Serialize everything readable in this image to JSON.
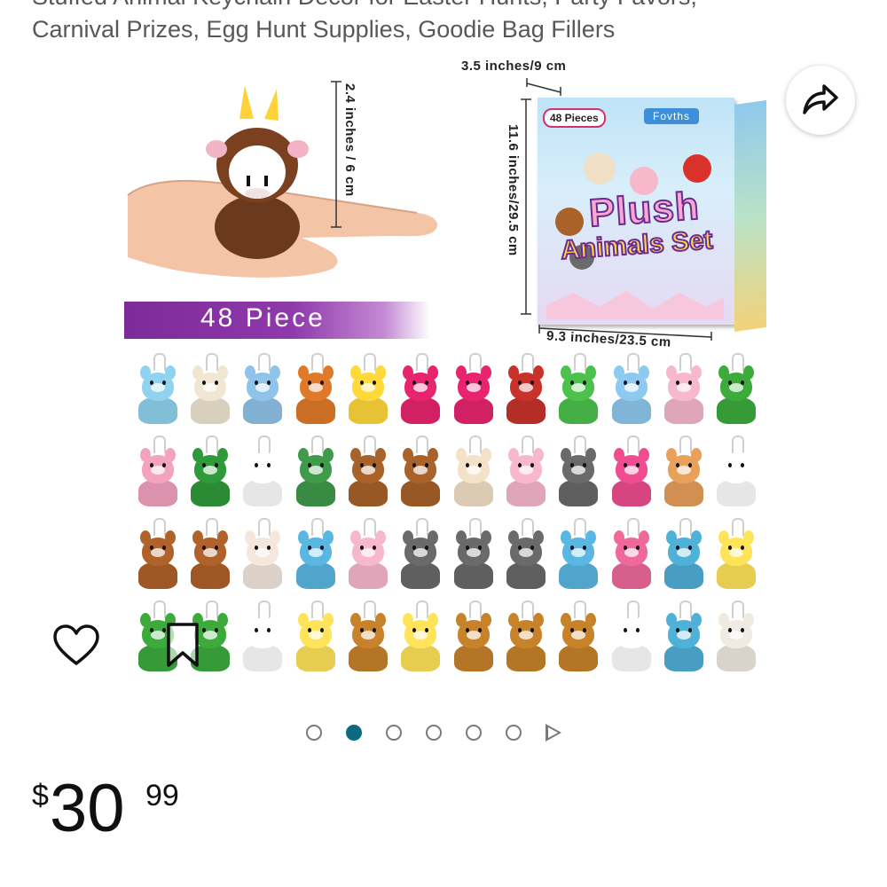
{
  "product": {
    "title_line1": "Stuffed Animal Keychain Decor for Easter Hunts, Party Favors,",
    "title_line2": "Carnival Prizes, Egg Hunt Supplies, Goodie Bag Fillers"
  },
  "gallery": {
    "dim_width": "3.5 inches/9 cm",
    "dim_height_small": "2.4 inches / 6 cm",
    "dim_height_box": "11.6 inches/29.5 cm",
    "dim_length": "9.3 inches/23.5 cm",
    "banner_text": "48 Piece",
    "box_tag": "48 Pieces",
    "box_brand": "Fovths",
    "box_title_line1": "Plush",
    "box_title_line2": "Animals Set",
    "current_image": 2,
    "total_dots": 6
  },
  "actions": {
    "share_icon": "share-arrow-icon",
    "wishlist_icon": "heart-outline-icon",
    "save_icon": "bookmark-outline-icon"
  },
  "price": {
    "currency": "$",
    "whole": "30",
    "fraction": "99"
  },
  "colors": {
    "dot_active": "#0b6a80",
    "banner_purple": "#8f39ab",
    "text_gray": "#565959"
  },
  "plush_colors": [
    [
      "#8fd3f0",
      "#f0e6d2",
      "#8fc3ea",
      "#e07a2a",
      "#ffd83a",
      "#e8246e",
      "#e8246e",
      "#c8322a",
      "#4cc24c",
      "#8ec9ef",
      "#f7b8cc",
      "#3cab3c"
    ],
    [
      "#f3a3c0",
      "#2f9a3a",
      "#ffffff",
      "#3f9a4a",
      "#a8622a",
      "#a8622a",
      "#f4e2c8",
      "#f7b8cc",
      "#6a6a6a",
      "#ef4d8f",
      "#e8a05a",
      "#ffffff"
    ],
    [
      "#b0622a",
      "#b0622a",
      "#f4e8de",
      "#5ab7e4",
      "#f7b8cc",
      "#6a6a6a",
      "#6a6a6a",
      "#6a6a6a",
      "#5ab7e4",
      "#ef6a9a",
      "#4fb0d8",
      "#ffe45a"
    ],
    [
      "#3cab3c",
      "#3cab3c",
      "#ffffff",
      "#ffe45a",
      "#c8822a",
      "#ffe45a",
      "#c8822a",
      "#c8822a",
      "#c8822a",
      "#ffffff",
      "#4fb0d8",
      "#f0ebe2"
    ]
  ]
}
